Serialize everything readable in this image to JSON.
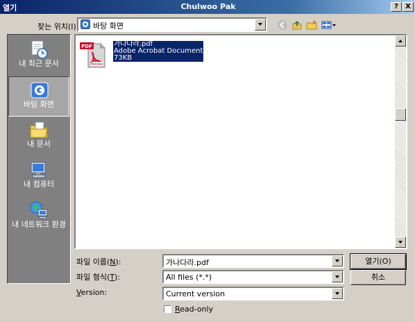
{
  "window": {
    "title": "열기",
    "center_title": "Chulwoo Pak",
    "help_button": "?",
    "close_button": "X"
  },
  "look_in": {
    "label": "찾는 위치(I):",
    "value": "바탕 화면"
  },
  "places": [
    {
      "label": "내 최근 문서",
      "icon": "recent-documents-icon"
    },
    {
      "label": "바탕 화면",
      "icon": "desktop-icon",
      "selected": true
    },
    {
      "label": "내 문서",
      "icon": "my-documents-icon"
    },
    {
      "label": "내 컴퓨터",
      "icon": "my-computer-icon"
    },
    {
      "label": "내 네트워크 환경",
      "icon": "network-places-icon"
    }
  ],
  "files": [
    {
      "name": "가나다라.pdf",
      "type": "Adobe Acrobat Document",
      "size": "73KB",
      "icon": "pdf-file-icon",
      "icon_badge": "PDF",
      "selected": true
    }
  ],
  "file_name": {
    "label_prefix": "파일 이름(",
    "accel": "N",
    "label_suffix": "):",
    "value": "가나다라.pdf"
  },
  "file_type": {
    "label_prefix": "파일 형식(",
    "accel": "T",
    "label_suffix": "):",
    "value": "All files (*.*)"
  },
  "version": {
    "accel": "V",
    "label_rest": "ersion:",
    "value": "Current version"
  },
  "read_only": {
    "accel": "R",
    "label_rest": "ead-only",
    "checked": false
  },
  "buttons": {
    "open": "열기(O)",
    "cancel": "취소"
  },
  "colors": {
    "titlebar": "#0a246a",
    "selection": "#0a246a",
    "places_bg": "#808080",
    "dialog_bg": "#d4d0c8",
    "pdf_red": "#c8102e"
  }
}
